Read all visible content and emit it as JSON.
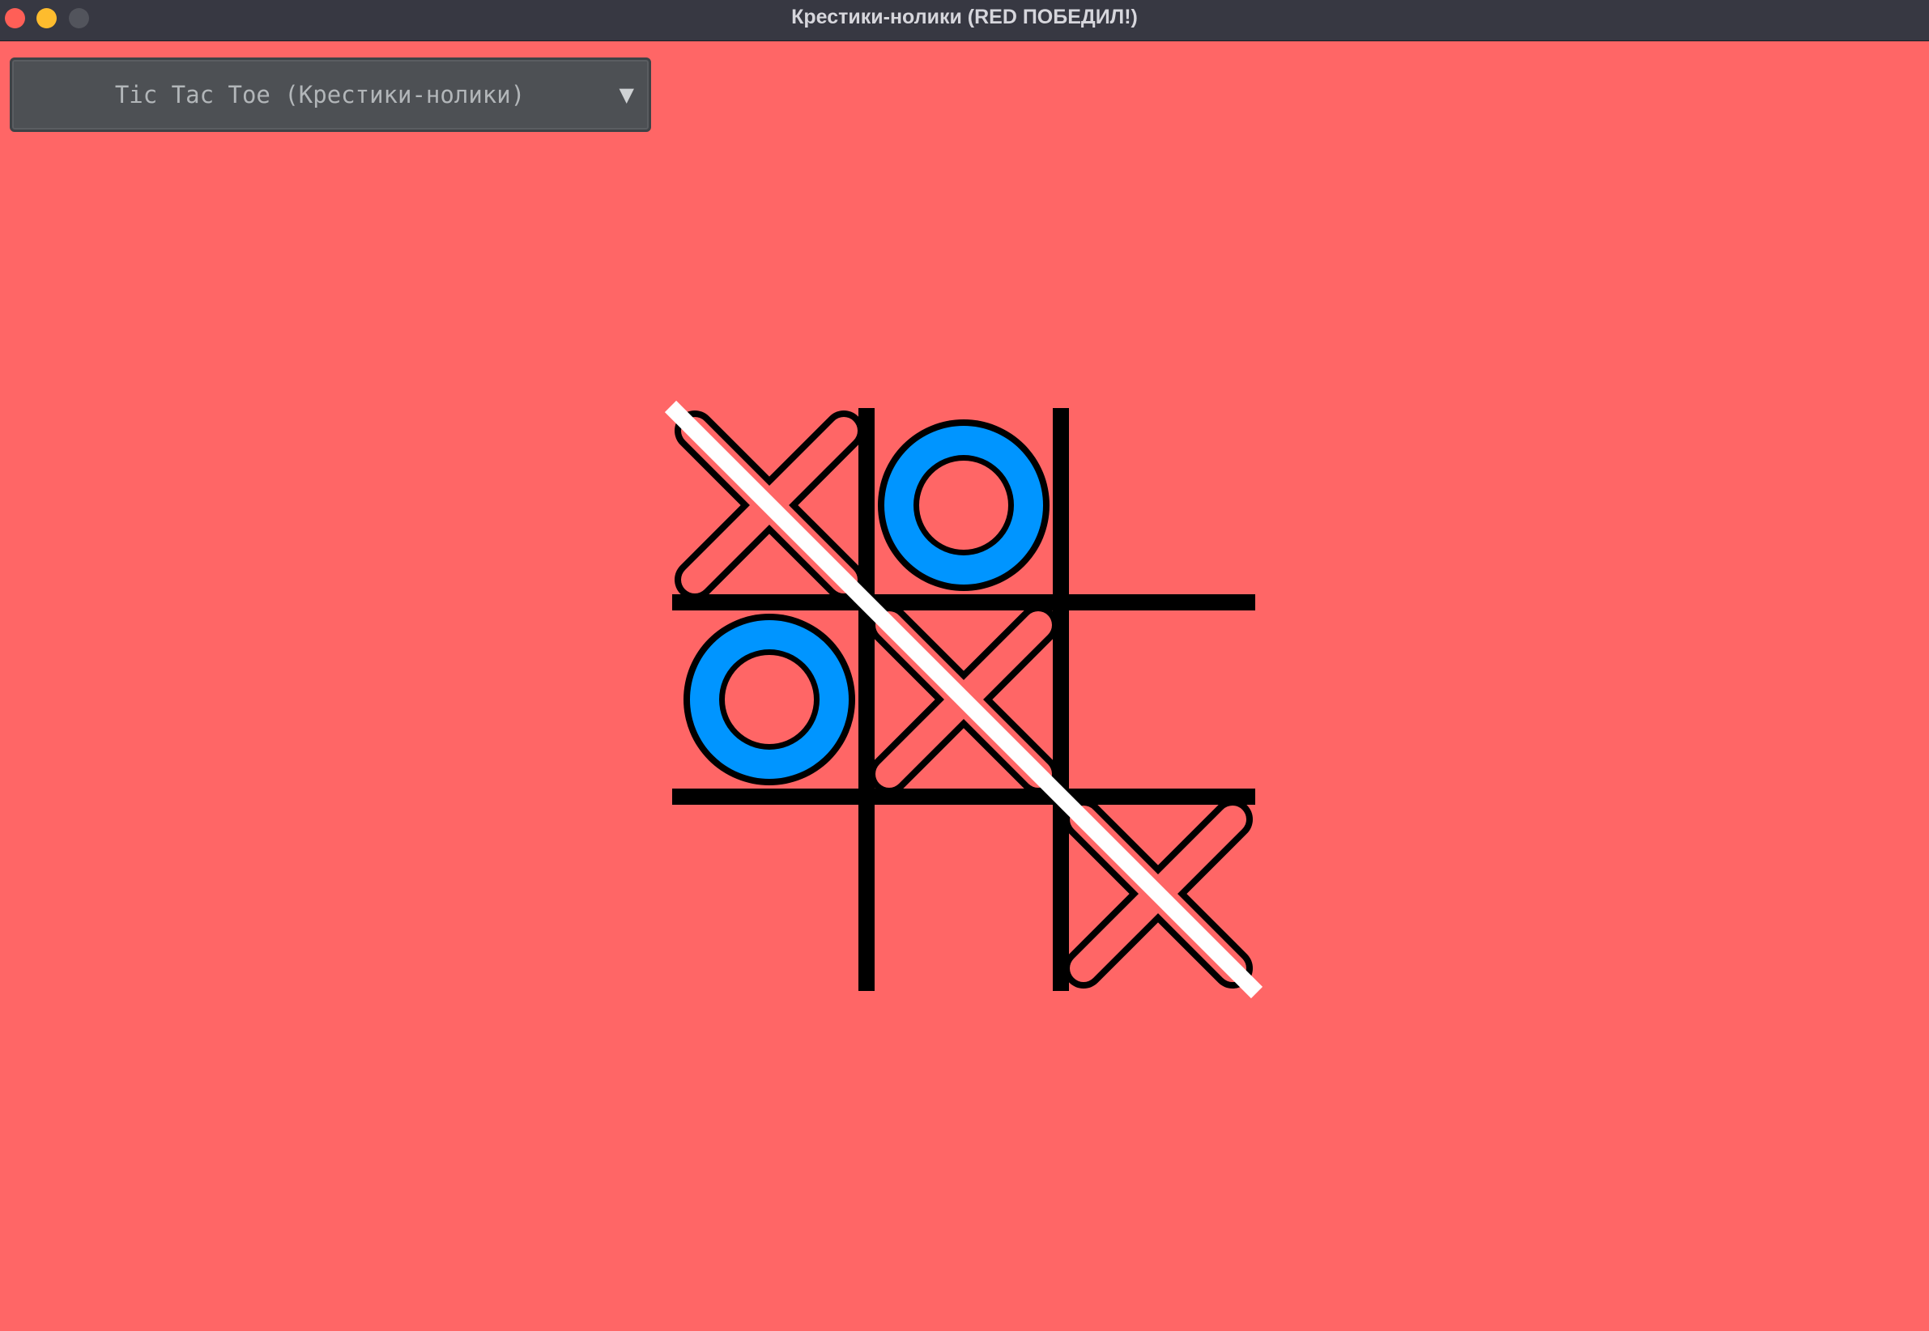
{
  "window": {
    "title": "Крестики-нолики (RED ПОБЕДИЛ!)",
    "controls": {
      "close_color": "#ff5f57",
      "minimize_color": "#febc2e",
      "maximize_color": "#52545c"
    }
  },
  "game_selector": {
    "selected": "Tic Tac Toe (Крестики-нолики)",
    "arrow_icon": "triangle-down-icon"
  },
  "board": {
    "background": "#ff6666",
    "grid_color": "#000000",
    "x_color": "#ff6666",
    "o_color": "#0095ff",
    "win_line_color": "#ffffff",
    "cells": [
      [
        "X",
        "O",
        ""
      ],
      [
        "O",
        "X",
        ""
      ],
      [
        "",
        "",
        "X"
      ]
    ],
    "winning_line": "diagonal-top-left-to-bottom-right"
  }
}
